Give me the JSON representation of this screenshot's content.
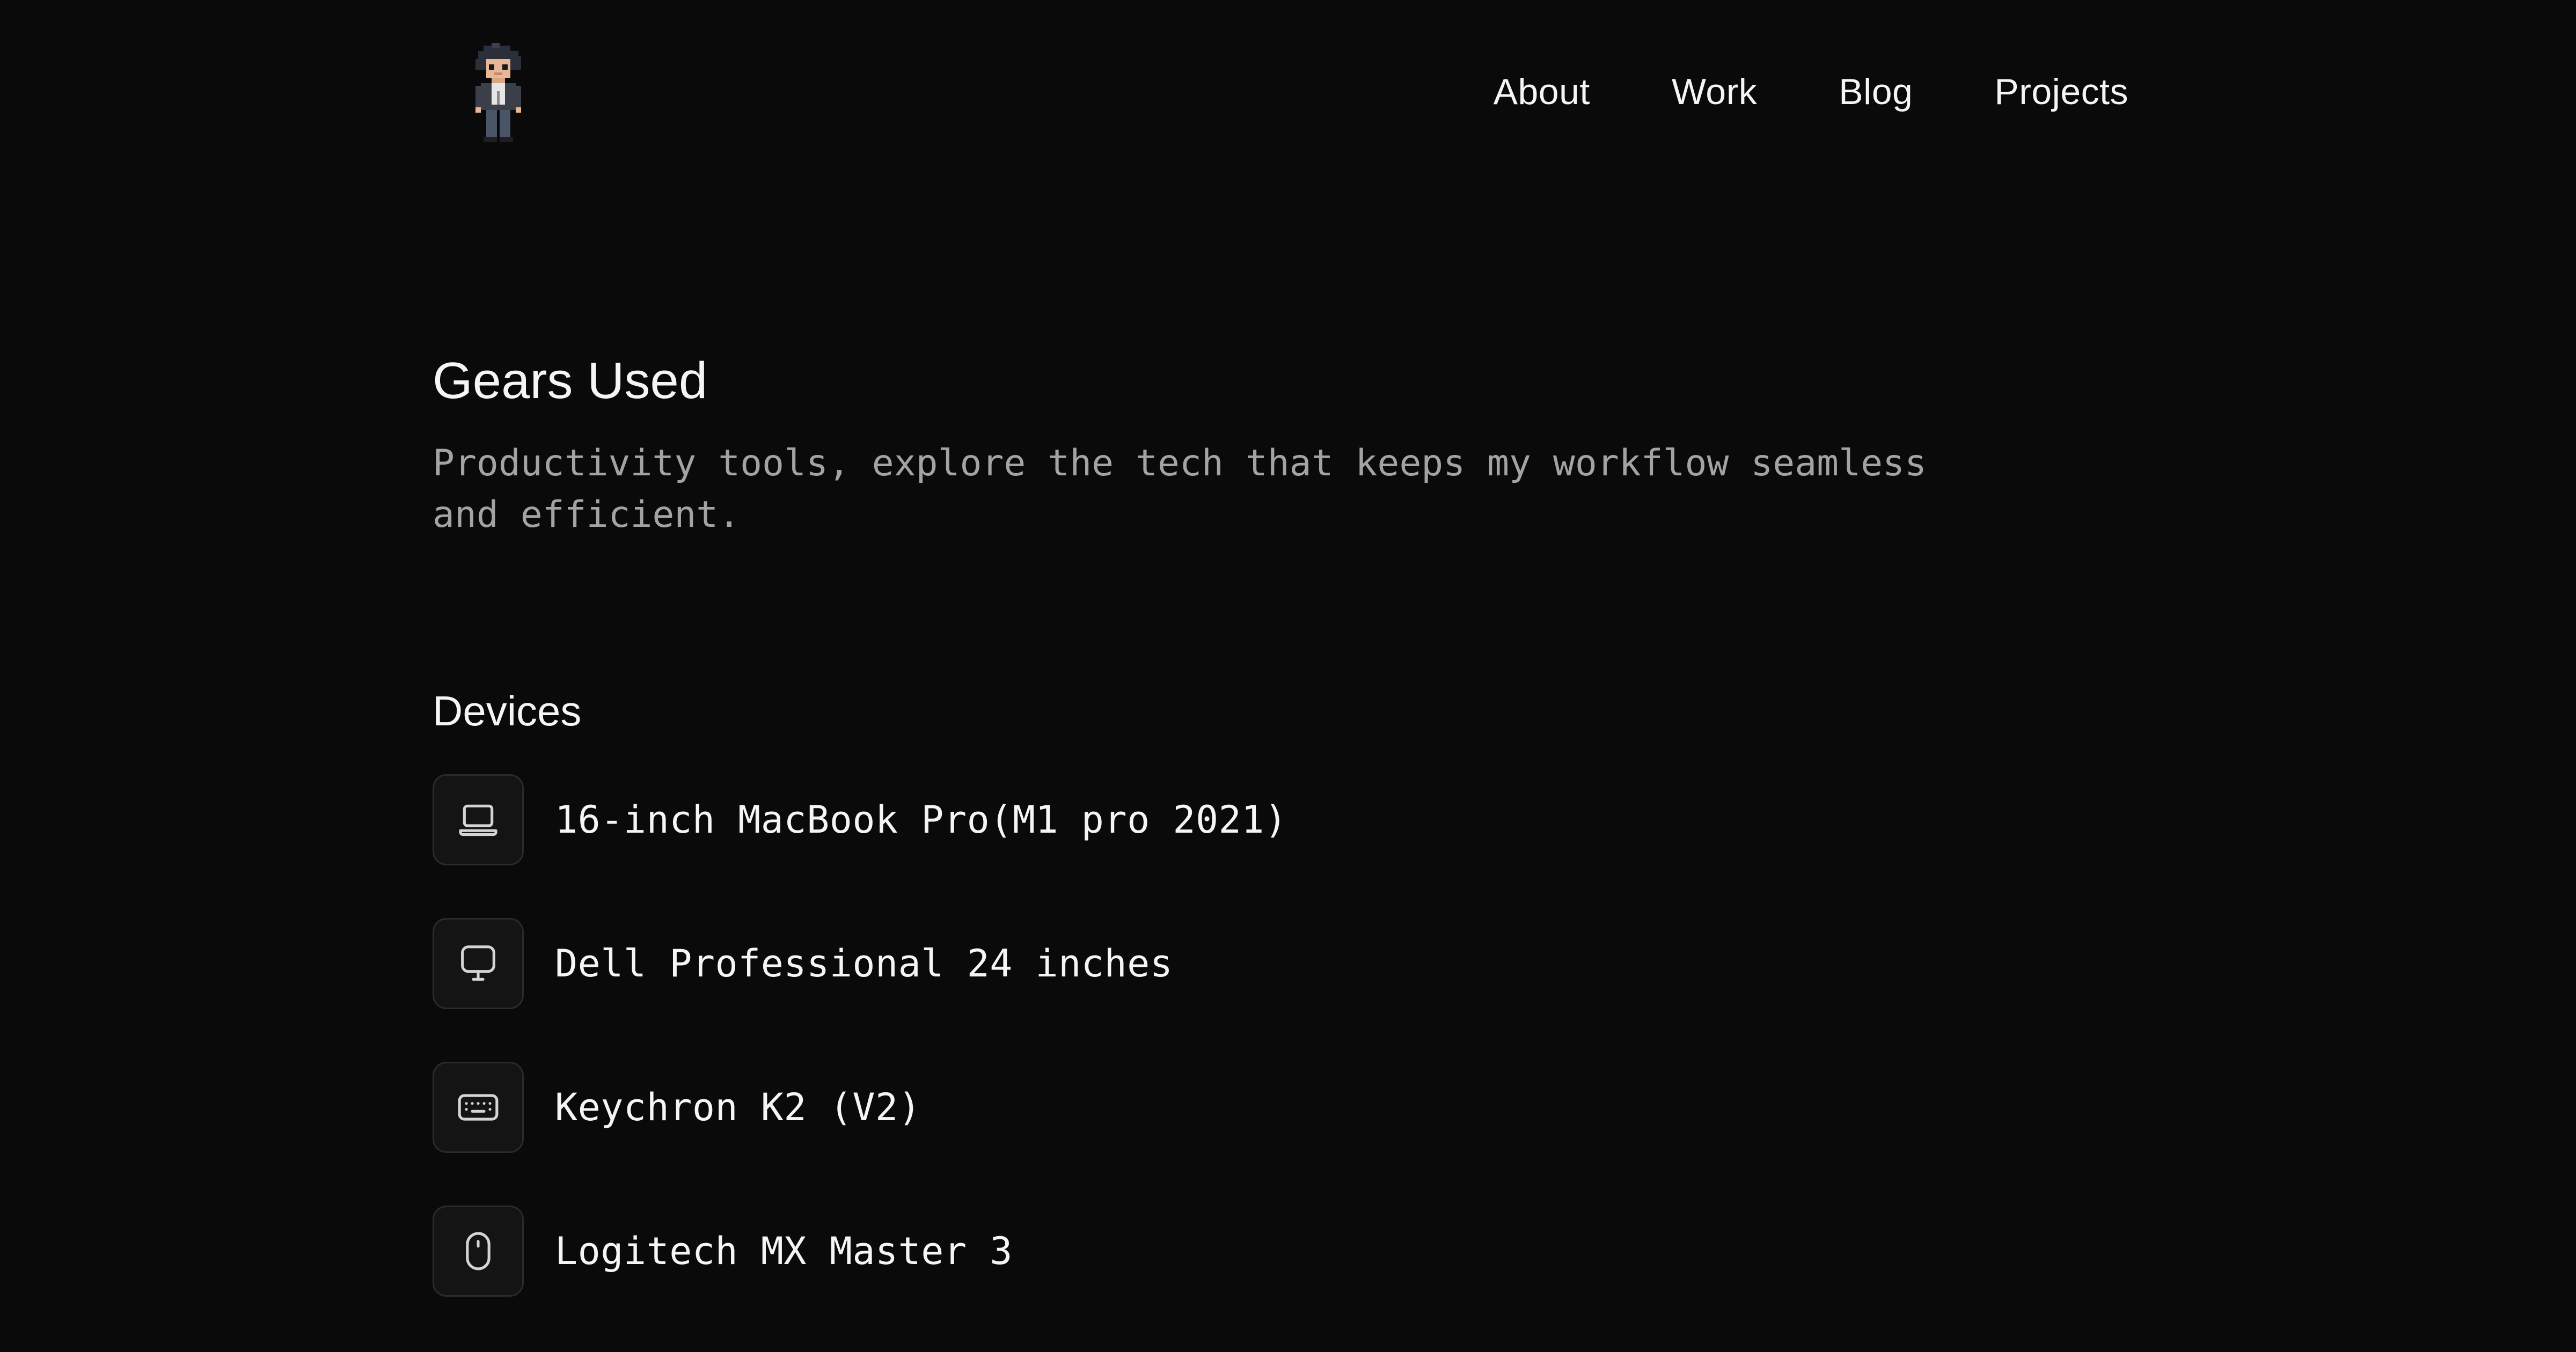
{
  "header": {
    "logo_icon": "pixel-avatar-icon",
    "nav": [
      {
        "label": "About"
      },
      {
        "label": "Work"
      },
      {
        "label": "Blog"
      },
      {
        "label": "Projects"
      }
    ]
  },
  "main": {
    "title": "Gears Used",
    "description": "Productivity tools, explore the tech that keeps my workflow seamless and efficient.",
    "sections": [
      {
        "title": "Devices",
        "items": [
          {
            "icon": "laptop-icon",
            "label": "16-inch MacBook Pro(M1 pro 2021)"
          },
          {
            "icon": "monitor-icon",
            "label": "Dell Professional 24 inches"
          },
          {
            "icon": "keyboard-icon",
            "label": "Keychron K2 (V2)"
          },
          {
            "icon": "mouse-icon",
            "label": "Logitech MX Master 3"
          }
        ]
      }
    ]
  },
  "colors": {
    "background": "#0a0a0a",
    "text": "#f5f5f5",
    "muted": "#a3a3a3",
    "icon_box_border": "#2a2a2a",
    "icon_box_bg": "#141414"
  }
}
